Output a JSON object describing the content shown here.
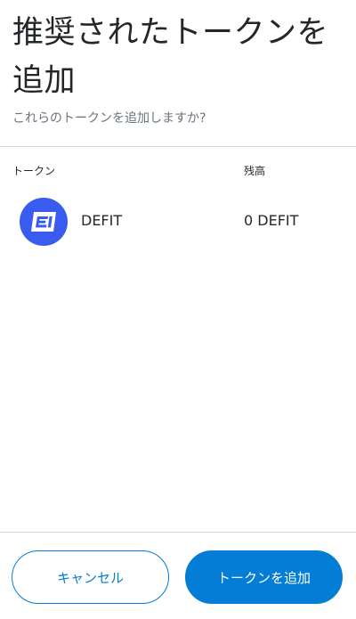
{
  "header": {
    "title": "推奨されたトークンを追加",
    "subtitle": "これらのトークンを追加しますか?"
  },
  "table": {
    "columns": {
      "token": "トークン",
      "balance": "残高"
    },
    "rows": [
      {
        "symbol": "DEFIT",
        "balance": "0 DEFIT",
        "logo_icon": "defit-token-icon",
        "logo_color": "#3a5bf0"
      }
    ]
  },
  "footer": {
    "cancel_label": "キャンセル",
    "confirm_label": "トークンを追加"
  },
  "colors": {
    "primary": "#037dd6",
    "text": "#24272a",
    "muted": "#6a737d",
    "divider": "#d6d9dc"
  }
}
